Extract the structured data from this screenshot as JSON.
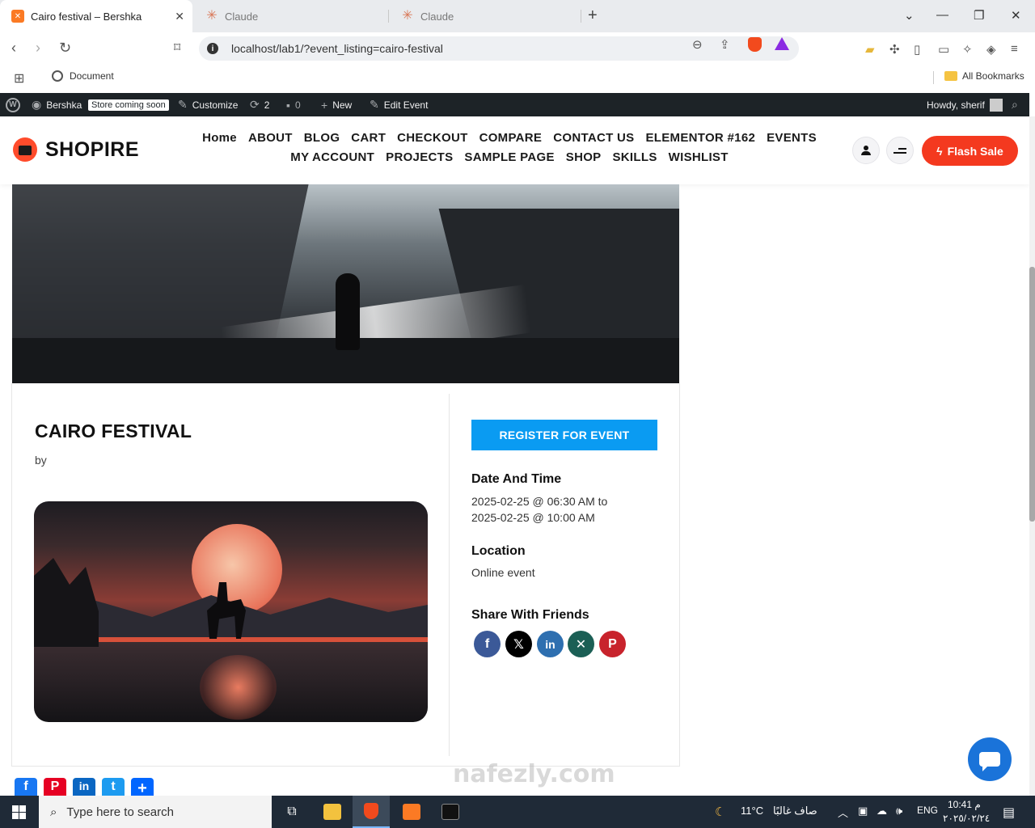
{
  "browser": {
    "tabs": [
      {
        "title": "Cairo festival – Bershka",
        "active": true
      },
      {
        "title": "Claude",
        "active": false
      },
      {
        "title": "Claude",
        "active": false
      }
    ],
    "url": "localhost/lab1/?event_listing=cairo-festival",
    "bookmarks": {
      "document": "Document",
      "all": "All Bookmarks"
    }
  },
  "admin_bar": {
    "site": "Bershka",
    "store_badge": "Store coming soon",
    "customize": "Customize",
    "updates": "2",
    "comments": "0",
    "new": "New",
    "edit": "Edit Event",
    "howdy": "Howdy, sherif"
  },
  "site": {
    "logo": "SHOPIRE",
    "menu": [
      "Home",
      "ABOUT",
      "BLOG",
      "CART",
      "CHECKOUT",
      "COMPARE",
      "CONTACT US",
      "ELEMENTOR #162",
      "EVENTS",
      "MY ACCOUNT",
      "PROJECTS",
      "SAMPLE PAGE",
      "SHOP",
      "SKILLS",
      "WISHLIST"
    ],
    "flash_sale": "Flash Sale",
    "accent": "#f4391f"
  },
  "event": {
    "title": "CAIRO FESTIVAL",
    "by": "by",
    "register": "REGISTER FOR EVENT",
    "date_heading": "Date And Time",
    "date_line1": "2025-02-25 @ 06:30 AM to",
    "date_line2": "2025-02-25 @ 10:00 AM",
    "location_heading": "Location",
    "location": "Online event",
    "share_heading": "Share With Friends",
    "share_icons": [
      "facebook-icon",
      "x-icon",
      "linkedin-icon",
      "xing-icon",
      "pinterest-icon"
    ],
    "register_color": "#0a9bf2"
  },
  "taskbar": {
    "search_placeholder": "Type here to search",
    "weather_temp": "11°C",
    "weather_text": "صاف غالبًا",
    "lang": "ENG",
    "time": "10:41 م",
    "date": "٢٠٢٥/٠٢/٢٤"
  },
  "watermark": "nafezly.com"
}
